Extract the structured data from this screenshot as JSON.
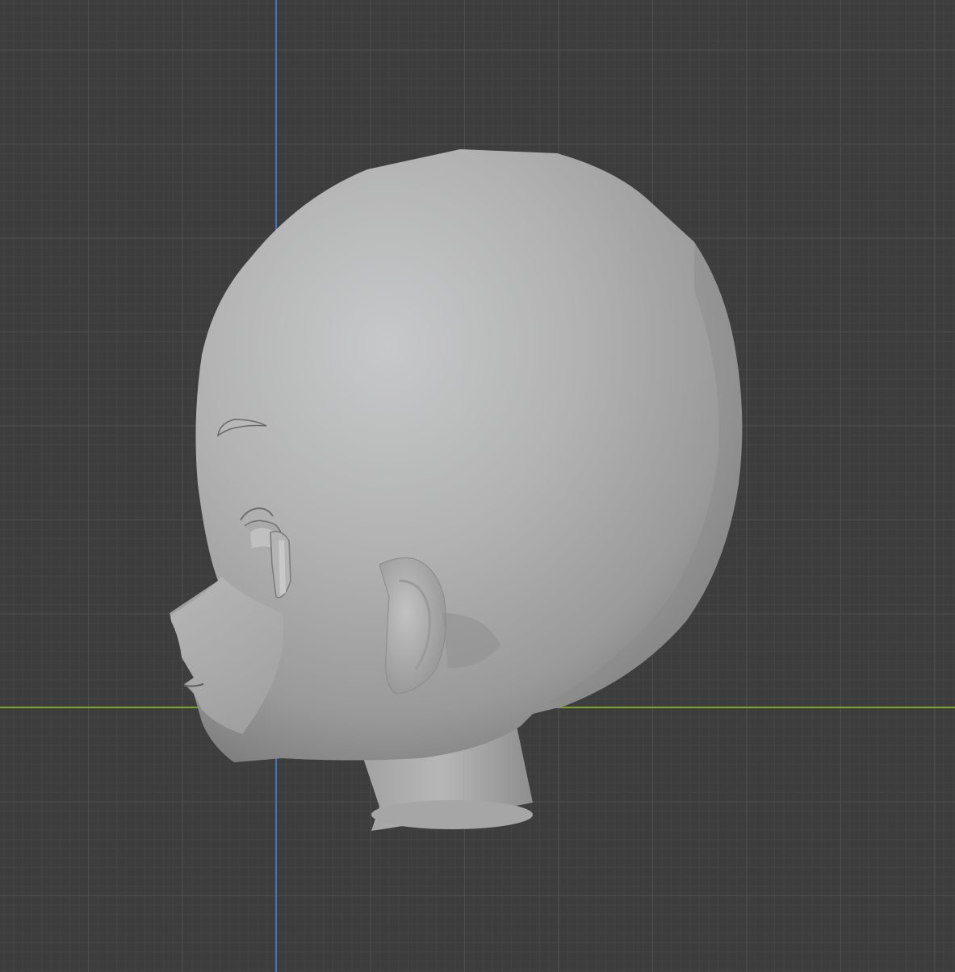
{
  "viewport": {
    "view": "3d-viewport-side",
    "background_color": "#3d3d3d",
    "grid_color": "#505050",
    "axis_colors": {
      "vertical_axis": "#3f76c0",
      "horizontal_axis": "#7aa62a"
    },
    "object": {
      "type": "head-mesh",
      "shading": "solid",
      "base_color": "#a9a9a9"
    }
  }
}
